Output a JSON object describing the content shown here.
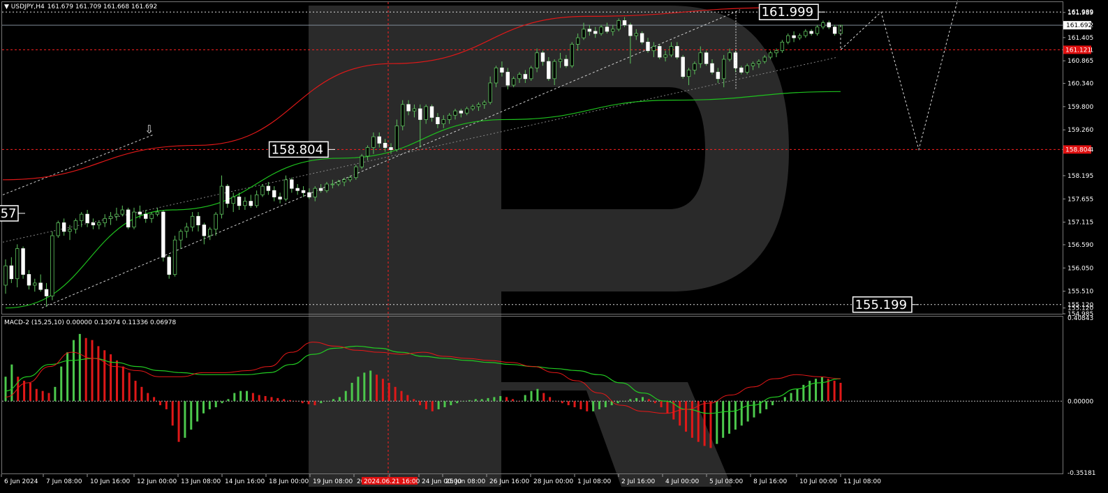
{
  "header": {
    "symbol": "USDJPY,H4",
    "quote": "161.679 161.709 161.668 161.692"
  },
  "macd_header": "MACD-2 (15,25,10) 0.00000 0.13074 0.11336 0.06978",
  "chart_data": {
    "type": "candlestick",
    "symbol": "USDJPY",
    "timeframe": "H4",
    "ylim": [
      154.985,
      162.1
    ],
    "y_ticks": [
      "161.989",
      "161.692",
      "161.405",
      "161.121",
      "160.865",
      "160.340",
      "159.800",
      "159.260",
      "158.804",
      "158.195",
      "157.655",
      "157.115",
      "156.590",
      "156.050",
      "155.510",
      "155.120",
      "154.985"
    ],
    "x_ticks": [
      "6 Jun 2024",
      "7 Jun 08:00",
      "10 Jun 16:00",
      "12 Jun 00:00",
      "13 Jun 08:00",
      "14 Jun 16:00",
      "18 Jun 00:00",
      "19 Jun 08:00",
      "20 Jun 16:00",
      "2024.06.21 16:00",
      "24 Jun 00:00",
      "25 Jun 08:00",
      "26 Jun 16:00",
      "28 Jun 00:00",
      "1 Jul 08:00",
      "2 Jul 16:00",
      "4 Jul 00:00",
      "5 Jul 08:00",
      "8 Jul 16:00",
      "10 Jul 00:00",
      "11 Jul 08:00"
    ],
    "levels": [
      {
        "value": 161.999,
        "label": "161.999",
        "axis_label": "161.989",
        "style": "white-dashed"
      },
      {
        "value": 161.692,
        "label": "",
        "axis_label": "161.692",
        "style": "current"
      },
      {
        "value": 161.121,
        "label": "",
        "axis_label": "161.121",
        "style": "red-dashed"
      },
      {
        "value": 158.804,
        "label": "158.804",
        "axis_label": "158.804",
        "style": "red-dashed"
      },
      {
        "value": 155.199,
        "label": "155.199",
        "axis_label": "155.120",
        "style": "white-dashed"
      }
    ],
    "partial_left_label": "57",
    "candles": [
      [
        155.65,
        156.25,
        155.45,
        156.1
      ],
      [
        156.1,
        156.3,
        155.7,
        155.8
      ],
      [
        155.8,
        156.6,
        155.6,
        156.5
      ],
      [
        156.5,
        156.55,
        155.8,
        155.9
      ],
      [
        155.9,
        156.0,
        155.55,
        155.65
      ],
      [
        155.65,
        155.8,
        155.5,
        155.7
      ],
      [
        155.7,
        155.9,
        155.5,
        155.55
      ],
      [
        155.55,
        155.7,
        155.15,
        155.4
      ],
      [
        155.4,
        156.9,
        155.3,
        156.8
      ],
      [
        156.8,
        157.15,
        156.75,
        157.1
      ],
      [
        157.1,
        157.2,
        156.8,
        156.9
      ],
      [
        156.9,
        157.05,
        156.7,
        156.95
      ],
      [
        156.95,
        157.2,
        156.85,
        157.15
      ],
      [
        157.15,
        157.35,
        157.0,
        157.3
      ],
      [
        157.3,
        157.4,
        157.0,
        157.1
      ],
      [
        157.1,
        157.2,
        156.95,
        157.05
      ],
      [
        157.05,
        157.15,
        156.95,
        157.1
      ],
      [
        157.1,
        157.3,
        157.0,
        157.2
      ],
      [
        157.2,
        157.35,
        157.05,
        157.25
      ],
      [
        157.25,
        157.45,
        157.15,
        157.3
      ],
      [
        157.3,
        157.5,
        157.25,
        157.4
      ],
      [
        157.4,
        157.45,
        156.95,
        157.0
      ],
      [
        157.0,
        157.45,
        156.95,
        157.35
      ],
      [
        157.35,
        157.5,
        157.2,
        157.3
      ],
      [
        157.3,
        157.4,
        157.1,
        157.2
      ],
      [
        157.2,
        157.35,
        157.1,
        157.3
      ],
      [
        157.3,
        157.45,
        157.25,
        157.35
      ],
      [
        157.35,
        157.4,
        156.2,
        156.3
      ],
      [
        156.3,
        156.35,
        155.8,
        155.9
      ],
      [
        155.9,
        156.8,
        155.85,
        156.7
      ],
      [
        156.7,
        156.95,
        156.5,
        156.9
      ],
      [
        156.9,
        157.1,
        156.75,
        157.0
      ],
      [
        157.0,
        157.35,
        156.9,
        157.25
      ],
      [
        157.25,
        157.35,
        156.9,
        157.05
      ],
      [
        157.05,
        157.1,
        156.6,
        156.8
      ],
      [
        156.8,
        157.0,
        156.7,
        156.95
      ],
      [
        156.95,
        157.35,
        156.8,
        157.3
      ],
      [
        157.3,
        158.2,
        157.2,
        157.95
      ],
      [
        157.95,
        158.0,
        157.45,
        157.55
      ],
      [
        157.55,
        157.8,
        157.35,
        157.7
      ],
      [
        157.7,
        157.8,
        157.4,
        157.5
      ],
      [
        157.5,
        157.7,
        157.4,
        157.6
      ],
      [
        157.6,
        157.75,
        157.45,
        157.5
      ],
      [
        157.5,
        157.85,
        157.45,
        157.75
      ],
      [
        157.75,
        158.0,
        157.7,
        157.95
      ],
      [
        157.95,
        158.05,
        157.75,
        157.85
      ],
      [
        157.85,
        157.95,
        157.6,
        157.7
      ],
      [
        157.7,
        157.8,
        157.55,
        157.65
      ],
      [
        157.65,
        158.2,
        157.6,
        158.1
      ],
      [
        158.1,
        158.15,
        157.8,
        157.9
      ],
      [
        157.9,
        158.0,
        157.75,
        157.85
      ],
      [
        157.85,
        157.95,
        157.7,
        157.8
      ],
      [
        157.8,
        157.9,
        157.65,
        157.7
      ],
      [
        157.7,
        157.95,
        157.6,
        157.9
      ],
      [
        157.9,
        158.0,
        157.8,
        157.85
      ],
      [
        157.85,
        158.05,
        157.8,
        158.0
      ],
      [
        158.0,
        158.1,
        157.9,
        158.0
      ],
      [
        158.0,
        158.1,
        157.95,
        158.05
      ],
      [
        158.05,
        158.15,
        157.95,
        158.1
      ],
      [
        158.1,
        158.2,
        158.05,
        158.15
      ],
      [
        158.15,
        158.45,
        158.1,
        158.4
      ],
      [
        158.4,
        158.7,
        158.35,
        158.65
      ],
      [
        158.65,
        158.9,
        158.55,
        158.85
      ],
      [
        158.85,
        159.2,
        158.7,
        159.1
      ],
      [
        159.1,
        159.2,
        158.85,
        158.95
      ],
      [
        158.95,
        159.05,
        158.75,
        158.85
      ],
      [
        158.85,
        158.95,
        158.7,
        158.8
      ],
      [
        158.8,
        159.5,
        158.75,
        159.35
      ],
      [
        159.35,
        159.95,
        159.25,
        159.85
      ],
      [
        159.85,
        159.95,
        159.6,
        159.7
      ],
      [
        159.7,
        159.85,
        159.55,
        159.75
      ],
      [
        159.75,
        159.85,
        158.85,
        159.5
      ],
      [
        159.5,
        159.85,
        159.4,
        159.8
      ],
      [
        159.8,
        159.85,
        159.45,
        159.55
      ],
      [
        159.55,
        159.65,
        159.3,
        159.4
      ],
      [
        159.4,
        159.6,
        159.3,
        159.5
      ],
      [
        159.5,
        159.65,
        159.4,
        159.6
      ],
      [
        159.6,
        159.75,
        159.5,
        159.7
      ],
      [
        159.7,
        159.75,
        159.55,
        159.65
      ],
      [
        159.65,
        159.8,
        159.6,
        159.75
      ],
      [
        159.75,
        159.85,
        159.7,
        159.8
      ],
      [
        159.8,
        159.9,
        159.7,
        159.85
      ],
      [
        159.85,
        159.95,
        159.75,
        159.9
      ],
      [
        159.9,
        160.5,
        159.85,
        160.35
      ],
      [
        160.35,
        160.75,
        160.25,
        160.7
      ],
      [
        160.7,
        160.85,
        160.5,
        160.6
      ],
      [
        160.6,
        160.7,
        160.2,
        160.3
      ],
      [
        160.3,
        160.5,
        160.25,
        160.45
      ],
      [
        160.45,
        160.6,
        160.35,
        160.55
      ],
      [
        160.55,
        160.65,
        160.35,
        160.45
      ],
      [
        160.45,
        160.75,
        160.4,
        160.7
      ],
      [
        160.7,
        161.15,
        160.6,
        161.05
      ],
      [
        161.05,
        161.1,
        160.75,
        160.85
      ],
      [
        160.85,
        160.95,
        160.4,
        160.45
      ],
      [
        160.45,
        160.9,
        160.3,
        160.85
      ],
      [
        160.85,
        161.05,
        160.7,
        160.9
      ],
      [
        160.9,
        161.0,
        160.7,
        160.75
      ],
      [
        160.75,
        161.3,
        160.7,
        161.25
      ],
      [
        161.25,
        161.5,
        161.1,
        161.4
      ],
      [
        161.4,
        161.75,
        161.35,
        161.6
      ],
      [
        161.6,
        161.7,
        161.45,
        161.55
      ],
      [
        161.55,
        161.65,
        161.4,
        161.5
      ],
      [
        161.5,
        161.7,
        161.45,
        161.65
      ],
      [
        161.65,
        161.75,
        161.5,
        161.55
      ],
      [
        161.55,
        161.7,
        161.45,
        161.6
      ],
      [
        161.6,
        161.85,
        161.55,
        161.8
      ],
      [
        161.8,
        161.88,
        161.65,
        161.7
      ],
      [
        161.7,
        161.75,
        160.8,
        161.45
      ],
      [
        161.45,
        161.6,
        161.35,
        161.5
      ],
      [
        161.5,
        161.55,
        161.25,
        161.3
      ],
      [
        161.3,
        161.4,
        161.05,
        161.1
      ],
      [
        161.1,
        161.3,
        160.95,
        161.2
      ],
      [
        161.2,
        161.25,
        160.9,
        160.95
      ],
      [
        160.95,
        161.1,
        160.85,
        161.0
      ],
      [
        161.0,
        161.3,
        160.95,
        161.2
      ],
      [
        161.2,
        161.3,
        160.9,
        160.95
      ],
      [
        160.95,
        161.0,
        160.45,
        160.5
      ],
      [
        160.5,
        160.7,
        160.3,
        160.65
      ],
      [
        160.65,
        160.85,
        160.55,
        160.8
      ],
      [
        160.8,
        161.2,
        160.7,
        161.05
      ],
      [
        161.05,
        161.1,
        160.75,
        160.8
      ],
      [
        160.8,
        160.9,
        160.55,
        160.6
      ],
      [
        160.6,
        160.7,
        160.35,
        160.45
      ],
      [
        160.45,
        161.0,
        160.25,
        160.9
      ],
      [
        160.9,
        161.15,
        160.85,
        161.05
      ],
      [
        161.05,
        161.1,
        160.6,
        160.7
      ],
      [
        160.7,
        160.75,
        160.55,
        160.6
      ],
      [
        160.6,
        160.8,
        160.55,
        160.75
      ],
      [
        160.75,
        160.85,
        160.65,
        160.8
      ],
      [
        160.8,
        160.9,
        160.7,
        160.85
      ],
      [
        160.85,
        161.0,
        160.8,
        160.95
      ],
      [
        160.95,
        161.1,
        160.9,
        161.05
      ],
      [
        161.05,
        161.15,
        160.95,
        161.1
      ],
      [
        161.1,
        161.35,
        161.05,
        161.3
      ],
      [
        161.3,
        161.5,
        161.25,
        161.45
      ],
      [
        161.45,
        161.55,
        161.3,
        161.4
      ],
      [
        161.4,
        161.5,
        161.35,
        161.45
      ],
      [
        161.45,
        161.6,
        161.4,
        161.55
      ],
      [
        161.55,
        161.6,
        161.45,
        161.5
      ],
      [
        161.5,
        161.7,
        161.45,
        161.65
      ],
      [
        161.65,
        161.8,
        161.6,
        161.75
      ],
      [
        161.75,
        161.8,
        161.6,
        161.65
      ],
      [
        161.65,
        161.7,
        161.45,
        161.5
      ],
      [
        161.5,
        161.7,
        161.45,
        161.692
      ]
    ],
    "ma_green": [
      155.12,
      157.4,
      158.6,
      159.5,
      159.95,
      160.15
    ],
    "ma_red": [
      158.1,
      158.9,
      160.8,
      161.9,
      162.1
    ],
    "forecast": [
      161.692,
      161.121,
      161.999,
      158.804,
      162.3
    ],
    "macd_ylim": [
      -0.35181,
      0.40843
    ],
    "macd_ticks": [
      "0.40843",
      "0.00000",
      "-0.35181"
    ],
    "macd_hist": [
      0.12,
      0.18,
      0.12,
      0.1,
      0.09,
      0.06,
      0.05,
      0.04,
      0.07,
      0.17,
      0.24,
      0.3,
      0.33,
      0.31,
      0.3,
      0.27,
      0.25,
      0.23,
      0.2,
      0.17,
      0.14,
      0.1,
      0.07,
      0.04,
      0.02,
      -0.02,
      -0.04,
      -0.12,
      -0.2,
      -0.18,
      -0.14,
      -0.1,
      -0.06,
      -0.04,
      -0.03,
      -0.01,
      0.01,
      0.04,
      0.05,
      0.05,
      0.04,
      0.03,
      0.025,
      0.02,
      0.015,
      0.01,
      0.005,
      0.0,
      -0.01,
      -0.015,
      -0.02,
      -0.01,
      0.0,
      0.01,
      0.02,
      0.05,
      0.09,
      0.12,
      0.14,
      0.15,
      0.13,
      0.11,
      0.09,
      0.07,
      0.05,
      0.03,
      0.01,
      -0.02,
      -0.04,
      -0.05,
      -0.04,
      -0.03,
      -0.02,
      -0.01,
      0.0,
      0.005,
      0.01,
      0.01,
      0.015,
      0.02,
      0.025,
      0.02,
      0.01,
      0.0,
      0.03,
      0.05,
      0.06,
      0.04,
      0.02,
      0.0,
      -0.01,
      -0.02,
      -0.03,
      -0.04,
      -0.05,
      -0.05,
      -0.04,
      -0.03,
      -0.02,
      -0.01,
      0.0,
      0.01,
      0.015,
      0.02,
      0.01,
      -0.01,
      -0.03,
      -0.06,
      -0.09,
      -0.12,
      -0.15,
      -0.18,
      -0.2,
      -0.22,
      -0.23,
      -0.21,
      -0.18,
      -0.16,
      -0.14,
      -0.12,
      -0.1,
      -0.08,
      -0.06,
      -0.04,
      -0.02,
      0.0,
      0.02,
      0.04,
      0.06,
      0.08,
      0.1,
      0.11,
      0.12,
      0.11,
      0.1,
      0.09
    ],
    "macd_signal_line": [
      0.05,
      0.12,
      0.18,
      0.2,
      0.21,
      0.19,
      0.17,
      0.15,
      0.14,
      0.13,
      0.13,
      0.13,
      0.14,
      0.18,
      0.23,
      0.26,
      0.27,
      0.26,
      0.24,
      0.22,
      0.21,
      0.2,
      0.19,
      0.18,
      0.17,
      0.16,
      0.15,
      0.13,
      0.09,
      0.04,
      0.0,
      -0.04,
      -0.06,
      -0.05,
      -0.02,
      0.02,
      0.06,
      0.09,
      0.11
    ],
    "macd_line": [
      0.02,
      0.09,
      0.17,
      0.24,
      0.21,
      0.17,
      0.15,
      0.12,
      0.12,
      0.14,
      0.14,
      0.15,
      0.17,
      0.24,
      0.29,
      0.27,
      0.25,
      0.24,
      0.23,
      0.24,
      0.22,
      0.21,
      0.2,
      0.19,
      0.17,
      0.14,
      0.1,
      0.04,
      -0.02,
      -0.05,
      -0.06,
      -0.04,
      -0.01,
      0.03,
      0.07,
      0.11,
      0.13,
      0.12,
      0.11
    ]
  }
}
